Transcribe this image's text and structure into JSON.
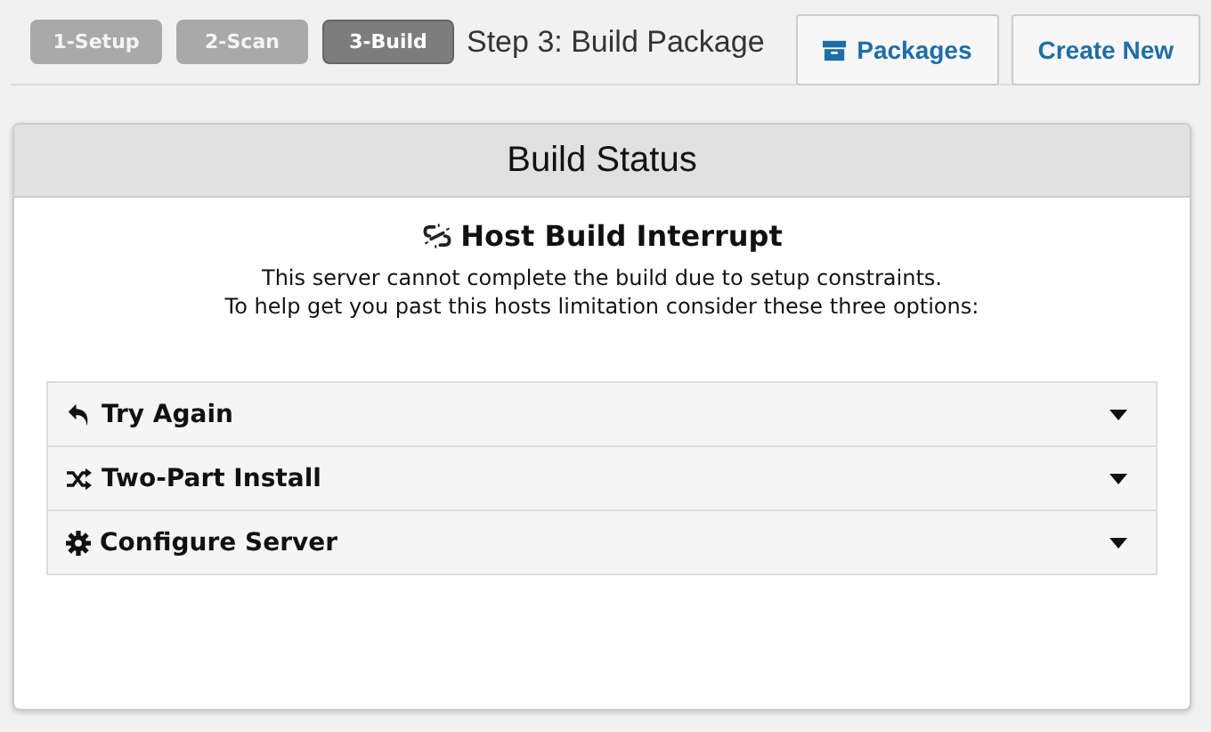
{
  "steps": [
    {
      "label": "1-Setup",
      "selected": false
    },
    {
      "label": "2-Scan",
      "selected": false
    },
    {
      "label": "3-Build",
      "selected": true
    }
  ],
  "step_title": "Step 3: Build Package",
  "header_buttons": [
    {
      "label": "Packages",
      "kind": "archive"
    },
    {
      "label": "Create New",
      "kind": "plain"
    }
  ],
  "panel": {
    "title": "Build Status",
    "heading": "Host Build Interrupt",
    "message": [
      "This server cannot complete the build due to setup constraints.",
      "To help get you past this hosts limitation consider these three options:"
    ],
    "options": [
      {
        "label": "Try Again",
        "kind": "undo",
        "expanded": false
      },
      {
        "label": "Two-Part Install",
        "kind": "shuffle",
        "expanded": false
      },
      {
        "label": "Configure Server",
        "kind": "gear",
        "expanded": false
      }
    ]
  }
}
